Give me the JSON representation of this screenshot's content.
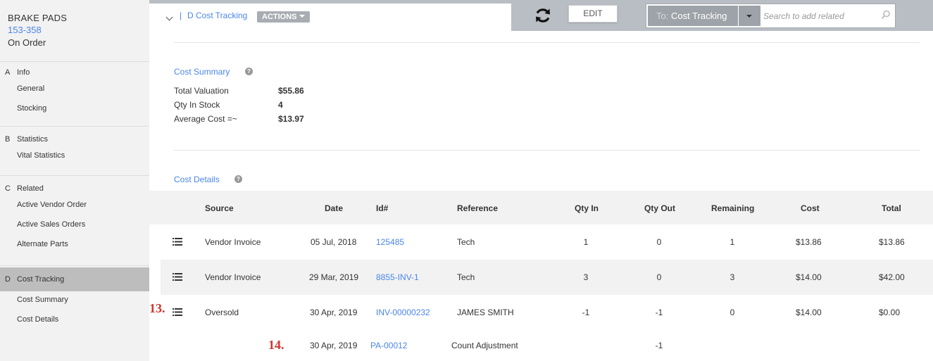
{
  "sidebar": {
    "title": "BRAKE PADS",
    "code": "153-358",
    "status": "On Order",
    "sections": [
      {
        "letter": "A",
        "label": "Info",
        "items": [
          "General",
          "Stocking"
        ]
      },
      {
        "letter": "B",
        "label": "Statistics",
        "items": [
          "Vital Statistics"
        ]
      },
      {
        "letter": "C",
        "label": "Related",
        "items": [
          "Active Vendor Order",
          "Active Sales Orders",
          "Alternate Parts"
        ]
      },
      {
        "letter": "D",
        "label": "Cost Tracking",
        "items": [
          "Cost Summary",
          "Cost Details"
        ],
        "active": true
      }
    ]
  },
  "topbar": {
    "pipe": "|",
    "breadcrumb": "D Cost Tracking",
    "actions_label": "ACTIONS",
    "edit_label": "EDIT",
    "to_prefix": "To:",
    "to_value": "Cost Tracking",
    "search_placeholder": "Search to add related"
  },
  "cost_summary": {
    "title": "Cost Summary",
    "help": "?",
    "rows": [
      {
        "label": "Total Valuation",
        "value": "$55.86"
      },
      {
        "label": "Qty In Stock",
        "value": "4"
      },
      {
        "label": "Average Cost =~",
        "value": "$13.97"
      }
    ]
  },
  "cost_details": {
    "title": "Cost Details",
    "help": "?",
    "columns": [
      "Source",
      "Date",
      "Id#",
      "Reference",
      "Qty In",
      "Qty Out",
      "Remaining",
      "Cost",
      "Total"
    ],
    "rows": [
      {
        "source": "Vendor Invoice",
        "date": "05 Jul, 2018",
        "id": "125485",
        "reference": "Tech",
        "qty_in": "1",
        "qty_out": "0",
        "remaining": "1",
        "cost": "$13.86",
        "total": "$13.86"
      },
      {
        "source": "Vendor Invoice",
        "date": "29 Mar, 2019",
        "id": "8855-INV-1",
        "reference": "Tech",
        "qty_in": "3",
        "qty_out": "0",
        "remaining": "3",
        "cost": "$14.00",
        "total": "$42.00"
      },
      {
        "source": "Oversold",
        "date": "30 Apr, 2019",
        "id": "INV-00000232",
        "reference": "JAMES SMITH",
        "qty_in": "-1",
        "qty_out": "-1",
        "remaining": "0",
        "cost": "$14.00",
        "total": "$0.00"
      }
    ],
    "sub_row": {
      "date": "30 Apr, 2019",
      "id": "PA-00012",
      "reference": "Count Adjustment",
      "qty_out": "-1"
    }
  },
  "annotations": [
    "13.",
    "14."
  ],
  "colors": {
    "link": "#4a86e8",
    "annotation": "#d0342c",
    "topbar": "#b9bec5",
    "sidebar": "#f2f2f2"
  }
}
